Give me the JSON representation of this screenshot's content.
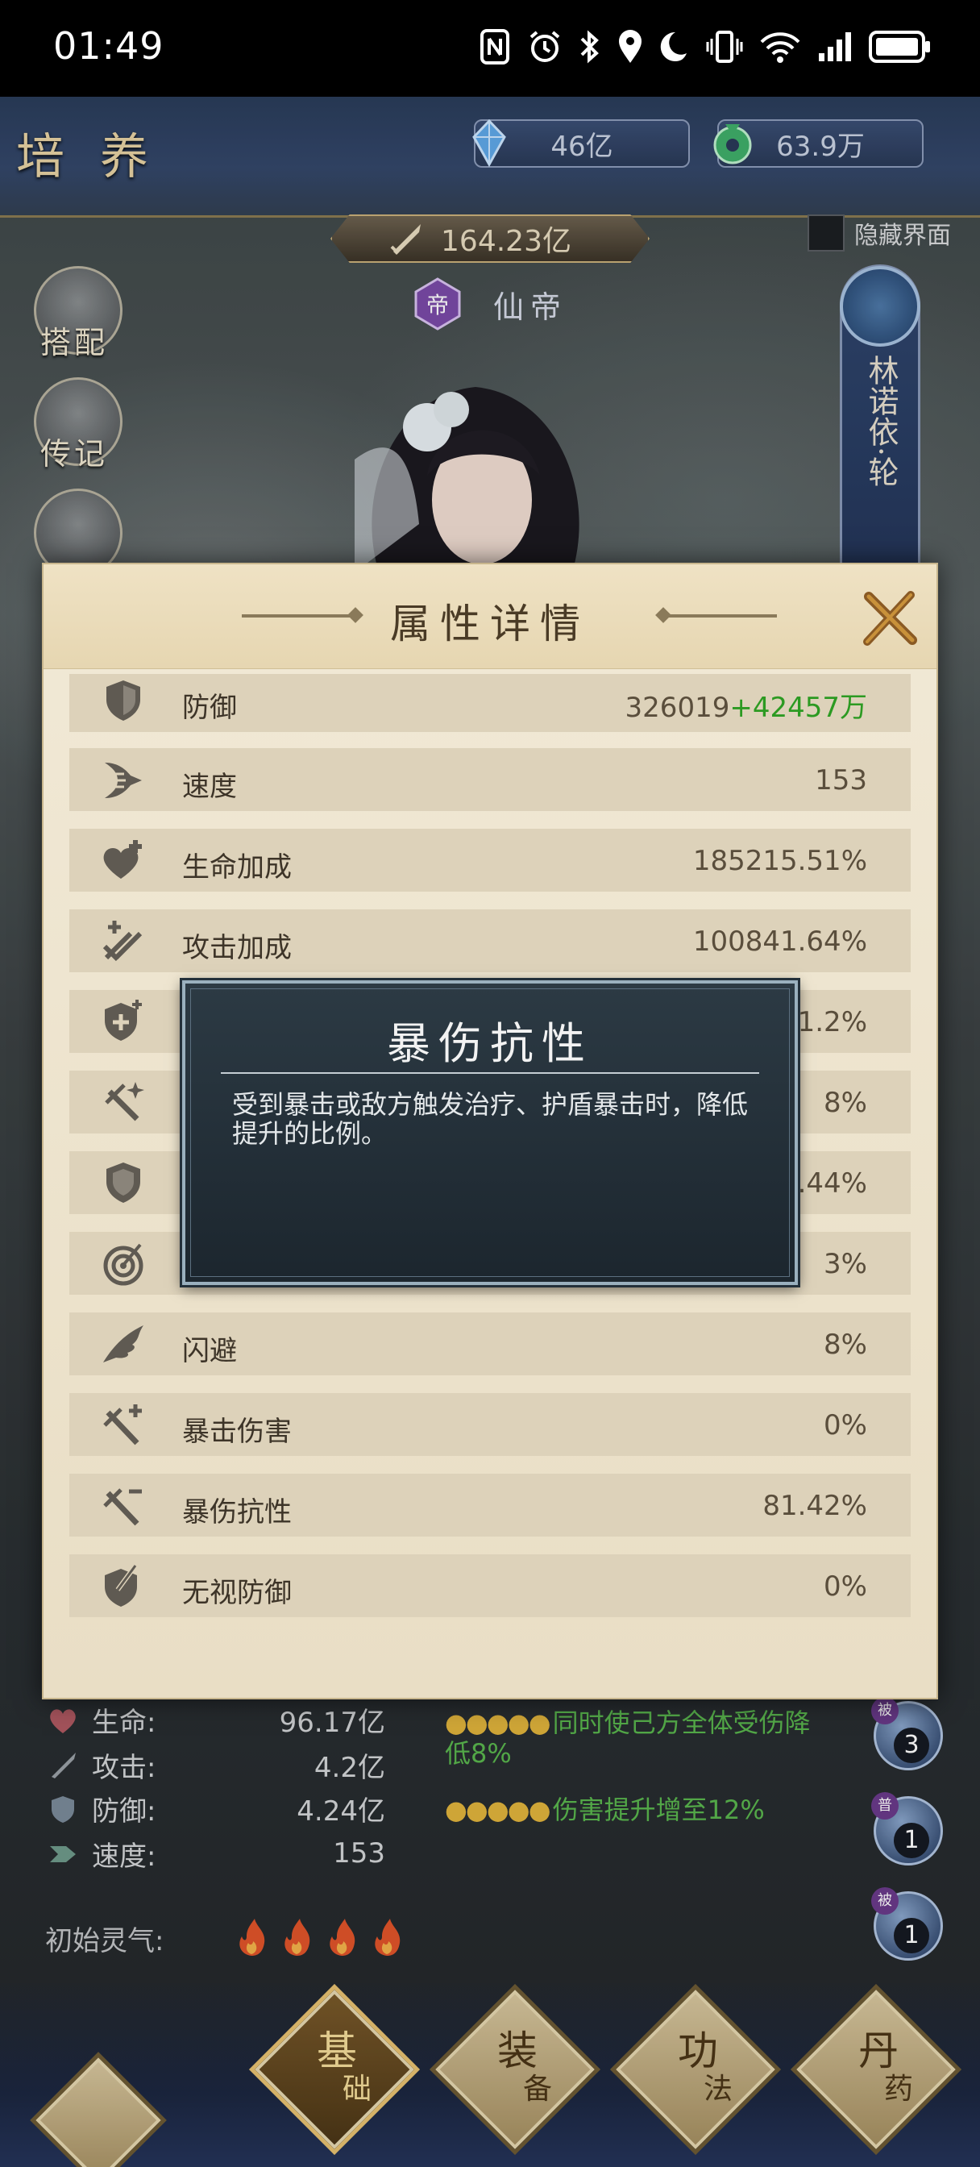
{
  "status_bar": {
    "time": "01:49",
    "icons": [
      "nfc-icon",
      "alarm-icon",
      "bluetooth-icon",
      "location-icon",
      "moon-icon",
      "vibrate-icon",
      "wifi-icon",
      "signal-icon",
      "battery-icon"
    ]
  },
  "header": {
    "title": "培养",
    "crystal_amount": "46亿",
    "jade_amount": "63.9万",
    "power": "164.23亿",
    "rank": "仙帝",
    "rank_emblem_char": "帝",
    "hide_ui_label": "隐藏界面"
  },
  "side_menu": {
    "items": [
      {
        "label": "搭配"
      },
      {
        "label": "传记"
      }
    ]
  },
  "hero": {
    "name": "林诺依·轮"
  },
  "modal": {
    "title": "属性详情",
    "attributes": [
      {
        "icon": "shield-icon",
        "name": "防御",
        "value": "326019",
        "bonus": "+42457万"
      },
      {
        "icon": "speed-icon",
        "name": "速度",
        "value": "153"
      },
      {
        "icon": "heart-plus-icon",
        "name": "生命加成",
        "value": "185215.51%"
      },
      {
        "icon": "swords-plus-icon",
        "name": "攻击加成",
        "value": "100841.64%"
      },
      {
        "icon": "shield-plus-icon",
        "name": "",
        "value": "81.2%"
      },
      {
        "icon": "sword-sparkle-icon",
        "name": "",
        "value": "8%"
      },
      {
        "icon": "shield-ring-icon",
        "name": "",
        "value": ".44%"
      },
      {
        "icon": "target-icon",
        "name": "",
        "value": "3%"
      },
      {
        "icon": "wing-icon",
        "name": "闪避",
        "value": "8%"
      },
      {
        "icon": "crit-damage-icon",
        "name": "暴击伤害",
        "value": "0%"
      },
      {
        "icon": "crit-resist-icon",
        "name": "暴伤抗性",
        "value": "81.42%"
      },
      {
        "icon": "pierce-icon",
        "name": "无视防御",
        "value": "0%"
      }
    ]
  },
  "tooltip": {
    "title": "暴伤抗性",
    "text": "受到暴击或敌方触发治疗、护盾暴击时，降低提升的比例。"
  },
  "base_stats": [
    {
      "icon": "heart-icon",
      "label": "生命:",
      "value": "96.17亿"
    },
    {
      "icon": "sword-icon",
      "label": "攻击:",
      "value": "4.2亿"
    },
    {
      "icon": "shield-icon",
      "label": "防御:",
      "value": "4.24亿"
    },
    {
      "icon": "speed-icon",
      "label": "速度:",
      "value": "153"
    }
  ],
  "aura": {
    "label": "初始灵气:",
    "flames": 4
  },
  "effects": [
    {
      "text": "同时使己方全体受伤降低8%"
    },
    {
      "text": "伤害提升增至12%"
    }
  ],
  "skills": [
    {
      "tag": "被",
      "level": "3"
    },
    {
      "tag": "普",
      "level": "1"
    },
    {
      "tag": "被",
      "level": "1"
    }
  ],
  "bottom_nav": [
    {
      "label": "基",
      "sub": "础",
      "active": true
    },
    {
      "label": "装",
      "sub": "备",
      "active": false
    },
    {
      "label": "功",
      "sub": "法",
      "active": false
    },
    {
      "label": "丹",
      "sub": "药",
      "active": false
    }
  ],
  "colors": {
    "bonus_green": "#2c9a22",
    "effect_green": "#59b64e",
    "modal_bg": "#f1e9d6",
    "row_bg": "#ddd2ba",
    "tooltip_bg": "#1c262e"
  }
}
